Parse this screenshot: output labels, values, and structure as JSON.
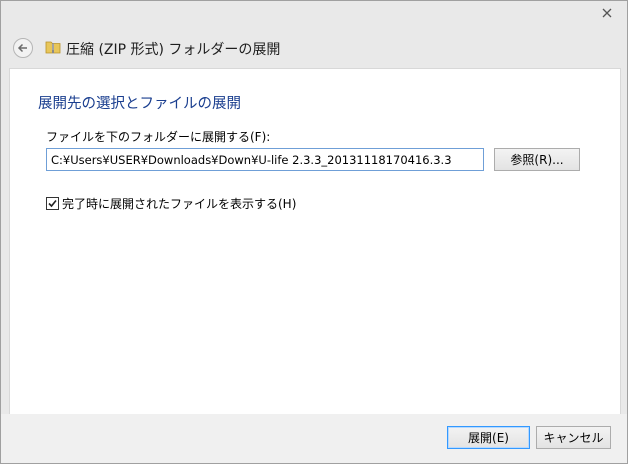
{
  "window": {
    "title": "圧縮 (ZIP 形式) フォルダーの展開"
  },
  "main": {
    "heading": "展開先の選択とファイルの展開",
    "folder_label": "ファイルを下のフォルダーに展開する(F):",
    "path_value": "C:¥Users¥USER¥Downloads¥Down¥U-life 2.3.3_20131118170416.3.3",
    "browse_label": "参照(R)...",
    "show_files_label": "完了時に展開されたファイルを表示する(H)",
    "show_files_checked": true
  },
  "footer": {
    "extract_label": "展開(E)",
    "cancel_label": "キャンセル"
  },
  "colors": {
    "heading": "#1a3e8f",
    "folder_icon": "#e8c65a",
    "default_button_border": "#3399ff"
  },
  "icons": {
    "close": "close-icon",
    "back": "back-arrow-icon",
    "folder": "zip-folder-icon",
    "check": "checkmark-icon"
  }
}
